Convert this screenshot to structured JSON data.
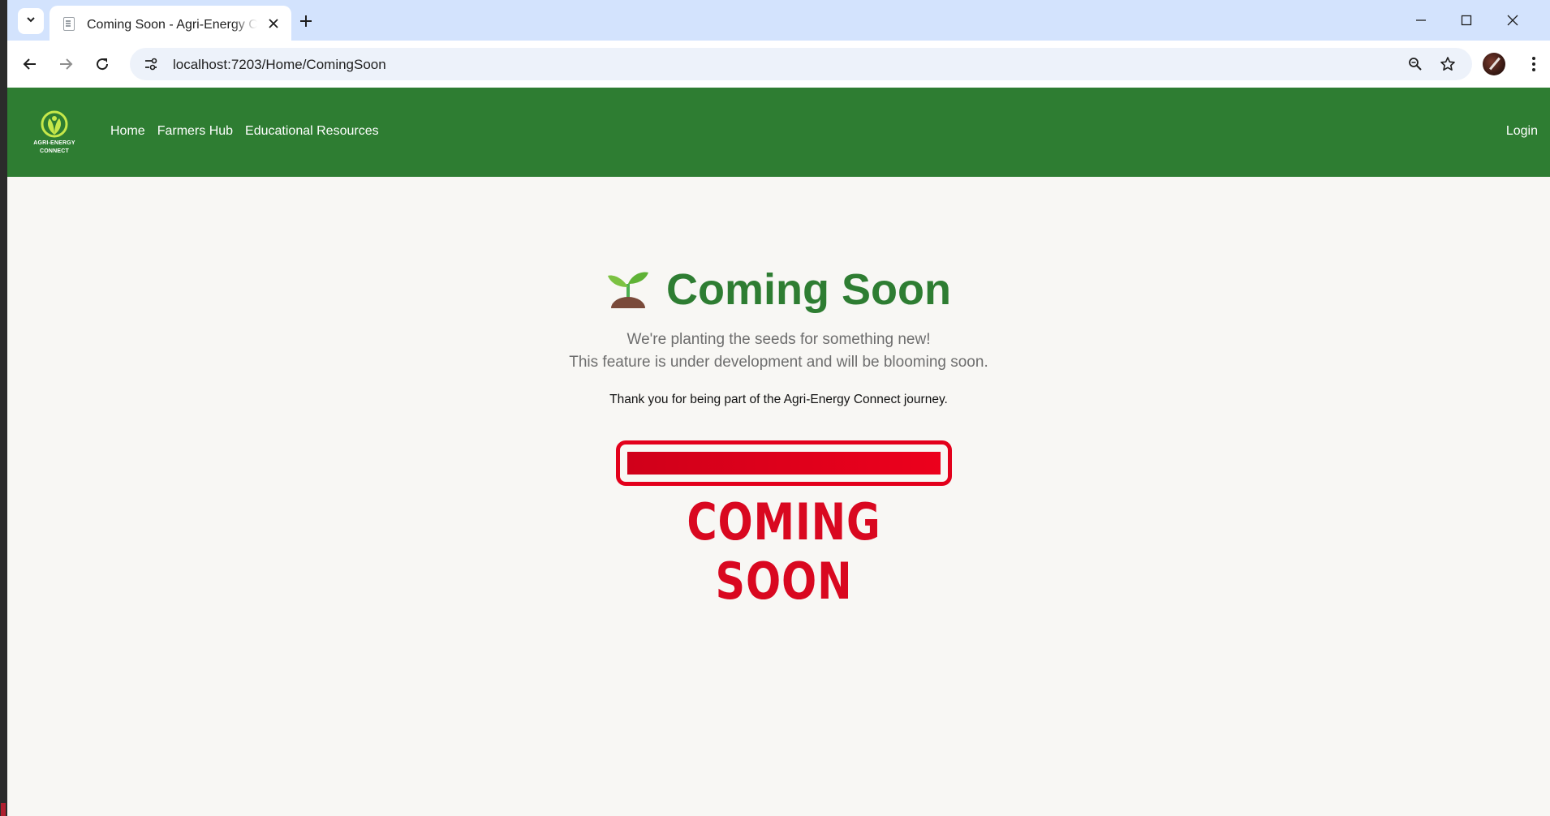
{
  "browser": {
    "tab_title": "Coming Soon - Agri-Energy Connect",
    "url": "localhost:7203/Home/ComingSoon"
  },
  "site": {
    "logo_line1": "AGRI-ENERGY",
    "logo_line2": "CONNECT",
    "nav": [
      "Home",
      "Farmers Hub",
      "Educational Resources"
    ],
    "login": "Login"
  },
  "content": {
    "emoji": "🌱",
    "heading": "Coming Soon",
    "subtitle_line1": "We're planting the seeds for something new!",
    "subtitle_line2": "This feature is under development and will be blooming soon.",
    "thanks": "Thank you for being part of the Agri-Energy Connect journey.",
    "graphic_text": "COMING SOON"
  },
  "colors": {
    "brand_green": "#2e7d32",
    "tab_strip": "#d3e3fd",
    "coming_soon_red": "#e3001b",
    "page_bg": "#f8f7f4"
  },
  "icons": [
    "tab-search-icon",
    "page-favicon-icon",
    "close-icon",
    "plus-icon",
    "minimize-icon",
    "maximize-icon",
    "window-close-icon",
    "back-arrow-icon",
    "forward-arrow-icon",
    "reload-icon",
    "site-info-icon",
    "zoom-icon",
    "bookmark-star-icon",
    "more-vert-icon",
    "seedling-icon"
  ]
}
